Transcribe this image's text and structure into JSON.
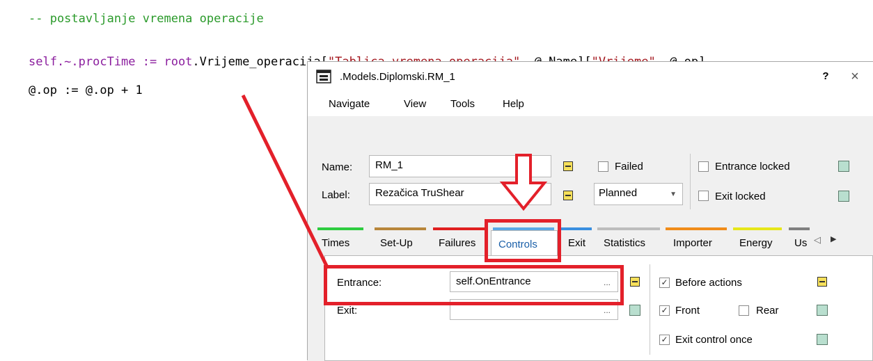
{
  "code": {
    "comment": "-- postavljanje vremena operacije",
    "line2_a": "self.~.procTime := ",
    "line2_b": "root",
    "line2_c": ".Vrijeme_operacija[",
    "line2_d": "\"Tablica vremena operacija\"",
    "line2_e": ", @.Name][",
    "line2_f": "\"Vrijeme\"",
    "line2_g": ", @.op]",
    "line3": "@.op := @.op + 1"
  },
  "dialog": {
    "title": ".Models.Diplomski.RM_1",
    "help": "?",
    "close": "×",
    "menu": [
      "Navigate",
      "View",
      "Tools",
      "Help"
    ],
    "name_label": "Name:",
    "name_value": "RM_1",
    "label_label": "Label:",
    "label_value": "Rezačica TruShear",
    "failed": "Failed",
    "status_select": "Planned",
    "entrance_locked": "Entrance locked",
    "exit_locked": "Exit locked",
    "tabs": [
      "Times",
      "Set-Up",
      "Failures",
      "Controls",
      "Exit",
      "Statistics",
      "Importer",
      "Energy",
      "Us"
    ],
    "active_tab": "Controls",
    "tab_colors": [
      "#2ecc40",
      "#b8863b",
      "#e02020",
      "#5aa9e6",
      "#3a8fe0",
      "#bdbdbd",
      "#f08c1a",
      "#e6e61a",
      "#808080"
    ],
    "scroll_left": "◁",
    "scroll_right": "▶",
    "controls": {
      "entrance_label": "Entrance:",
      "entrance_value": "self.OnEntrance",
      "exit_label": "Exit:",
      "exit_value": "",
      "ellipsis": "...",
      "before_actions": "Before actions",
      "front": "Front",
      "rear": "Rear",
      "exit_control_once": "Exit control once"
    }
  },
  "annotation_color": "#e3202a"
}
